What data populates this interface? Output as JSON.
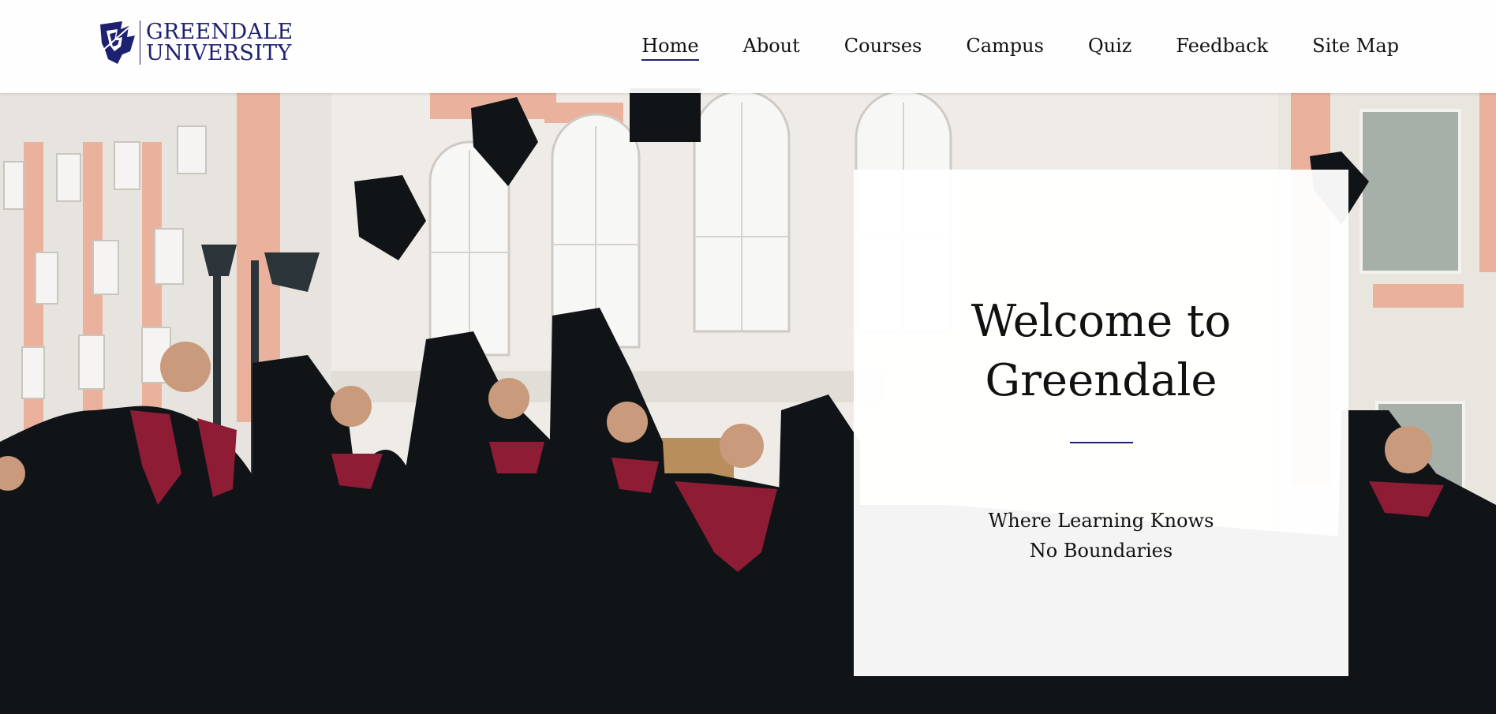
{
  "brand": {
    "line1": "GREENDALE",
    "line2": "UNIVERSITY",
    "logo_icon": "university-crest-icon",
    "color": "#1e2170"
  },
  "nav": {
    "items": [
      {
        "label": "Home",
        "active": true
      },
      {
        "label": "About",
        "active": false
      },
      {
        "label": "Courses",
        "active": false
      },
      {
        "label": "Campus",
        "active": false
      },
      {
        "label": "Quiz",
        "active": false
      },
      {
        "label": "Feedback",
        "active": false
      },
      {
        "label": "Site Map",
        "active": false
      }
    ]
  },
  "hero": {
    "image": "graduates-throwing-caps-photo",
    "title_line1": "Welcome to",
    "title_line2": "Greendale",
    "subtitle_line1": "Where Learning Knows",
    "subtitle_line2": "No Boundaries"
  },
  "colors": {
    "accent": "#1e2170",
    "gown": "#121418",
    "hood": "#8e1c35",
    "building": "#ece9e4",
    "building_trim": "#e8a78f"
  }
}
